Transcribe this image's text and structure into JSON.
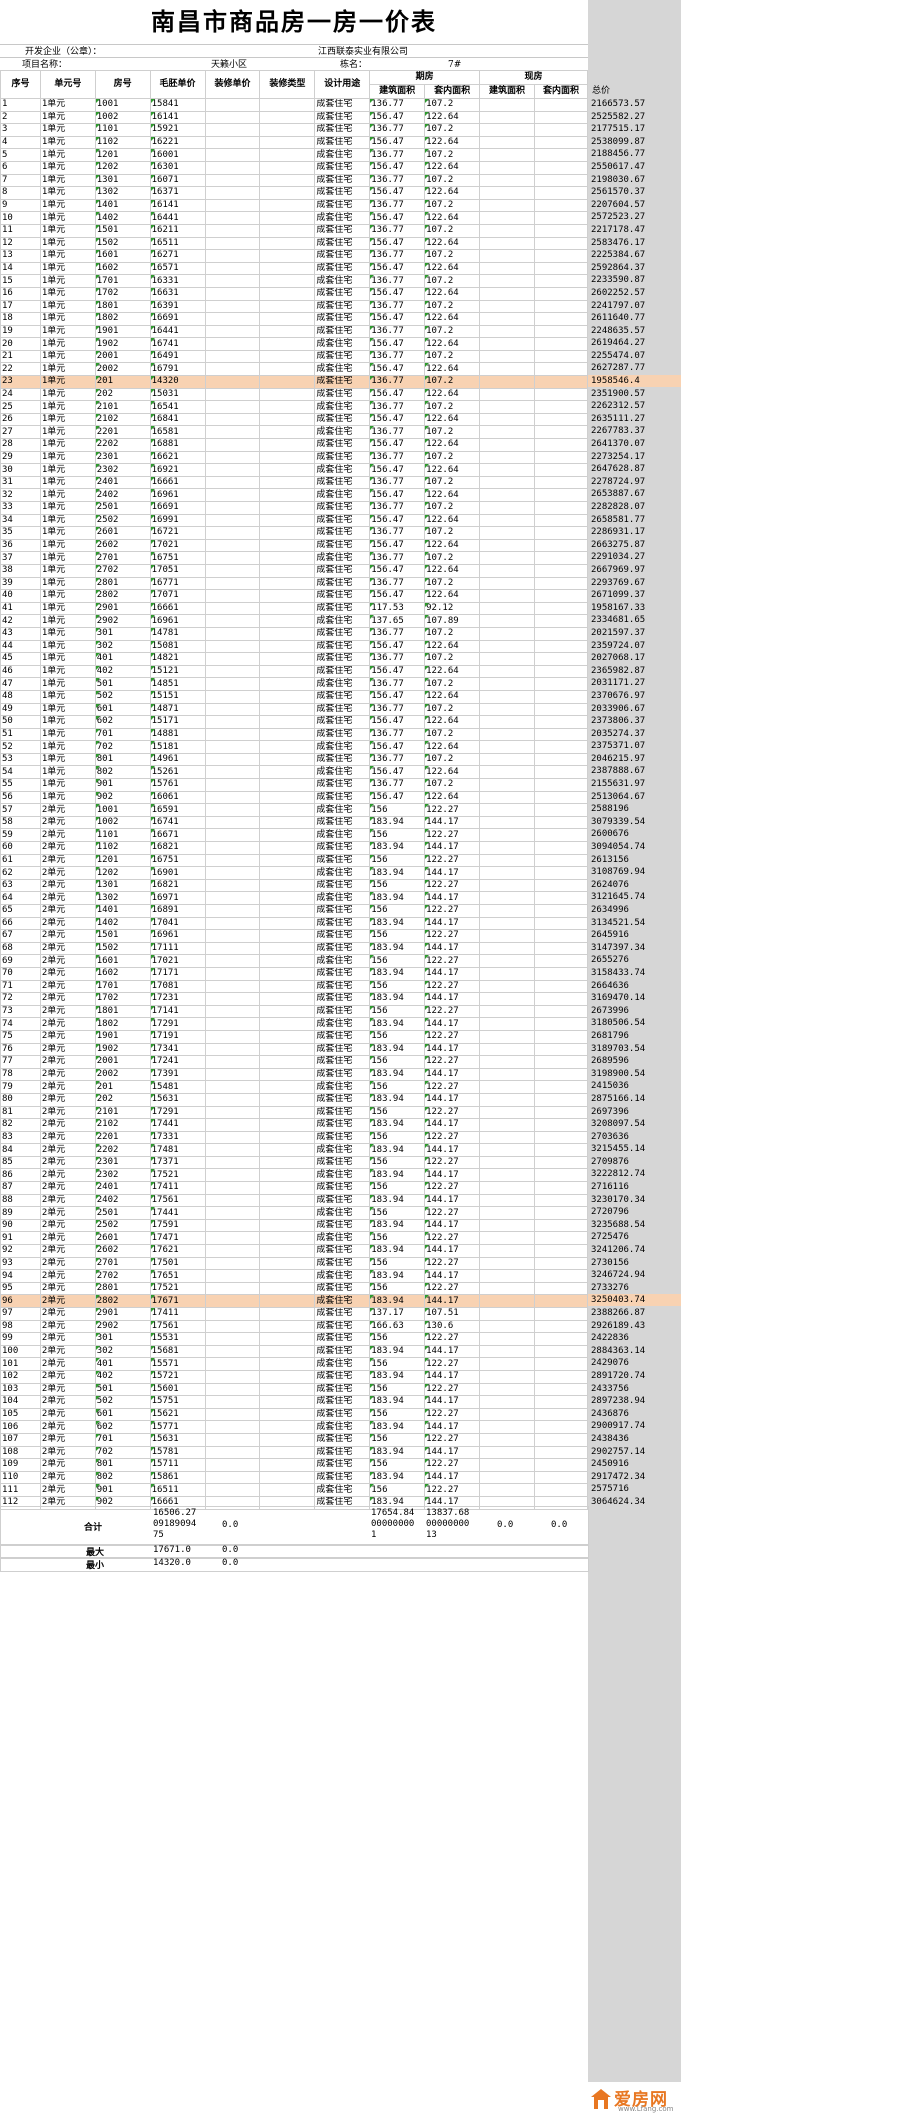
{
  "title": "南昌市商品房一房一价表",
  "developer_label": "开发企业（公章）：",
  "developer_value": "江西联泰实业有限公司",
  "project_label": "项目名称：",
  "project_value": "天籁小区",
  "building_label": "栋名：",
  "building_value": "7#",
  "headers": {
    "seq": "序号",
    "unit": "单元号",
    "room": "房号",
    "price": "毛胚单价",
    "deco_price": "装修单价",
    "deco_type": "装修类型",
    "usage": "设计用途",
    "future": "期房",
    "current": "现房",
    "build_area": "建筑面积",
    "inner_area": "套内面积",
    "build_area2": "建筑面积",
    "inner_area2": "套内面积",
    "total": "总价"
  },
  "usage_value": "成套住宅",
  "rows": [
    [
      "1",
      "1单元",
      "1001",
      "15841",
      "136.77",
      "107.2",
      "2166573.57"
    ],
    [
      "2",
      "1单元",
      "1002",
      "16141",
      "156.47",
      "122.64",
      "2525582.27"
    ],
    [
      "3",
      "1单元",
      "1101",
      "15921",
      "136.77",
      "107.2",
      "2177515.17"
    ],
    [
      "4",
      "1单元",
      "1102",
      "16221",
      "156.47",
      "122.64",
      "2538099.87"
    ],
    [
      "5",
      "1单元",
      "1201",
      "16001",
      "136.77",
      "107.2",
      "2188456.77"
    ],
    [
      "6",
      "1单元",
      "1202",
      "16301",
      "156.47",
      "122.64",
      "2550617.47"
    ],
    [
      "7",
      "1单元",
      "1301",
      "16071",
      "136.77",
      "107.2",
      "2198030.67"
    ],
    [
      "8",
      "1单元",
      "1302",
      "16371",
      "156.47",
      "122.64",
      "2561570.37"
    ],
    [
      "9",
      "1单元",
      "1401",
      "16141",
      "136.77",
      "107.2",
      "2207604.57"
    ],
    [
      "10",
      "1单元",
      "1402",
      "16441",
      "156.47",
      "122.64",
      "2572523.27"
    ],
    [
      "11",
      "1单元",
      "1501",
      "16211",
      "136.77",
      "107.2",
      "2217178.47"
    ],
    [
      "12",
      "1单元",
      "1502",
      "16511",
      "156.47",
      "122.64",
      "2583476.17"
    ],
    [
      "13",
      "1单元",
      "1601",
      "16271",
      "136.77",
      "107.2",
      "2225384.67"
    ],
    [
      "14",
      "1单元",
      "1602",
      "16571",
      "156.47",
      "122.64",
      "2592864.37"
    ],
    [
      "15",
      "1单元",
      "1701",
      "16331",
      "136.77",
      "107.2",
      "2233590.87"
    ],
    [
      "16",
      "1单元",
      "1702",
      "16631",
      "156.47",
      "122.64",
      "2602252.57"
    ],
    [
      "17",
      "1单元",
      "1801",
      "16391",
      "136.77",
      "107.2",
      "2241797.07"
    ],
    [
      "18",
      "1单元",
      "1802",
      "16691",
      "156.47",
      "122.64",
      "2611640.77"
    ],
    [
      "19",
      "1单元",
      "1901",
      "16441",
      "136.77",
      "107.2",
      "2248635.57"
    ],
    [
      "20",
      "1单元",
      "1902",
      "16741",
      "156.47",
      "122.64",
      "2619464.27"
    ],
    [
      "21",
      "1单元",
      "2001",
      "16491",
      "136.77",
      "107.2",
      "2255474.07"
    ],
    [
      "22",
      "1单元",
      "2002",
      "16791",
      "156.47",
      "122.64",
      "2627287.77"
    ],
    [
      "23",
      "1单元",
      "201",
      "14320",
      "136.77",
      "107.2",
      "1958546.4"
    ],
    [
      "24",
      "1单元",
      "202",
      "15031",
      "156.47",
      "122.64",
      "2351900.57"
    ],
    [
      "25",
      "1单元",
      "2101",
      "16541",
      "136.77",
      "107.2",
      "2262312.57"
    ],
    [
      "26",
      "1单元",
      "2102",
      "16841",
      "156.47",
      "122.64",
      "2635111.27"
    ],
    [
      "27",
      "1单元",
      "2201",
      "16581",
      "136.77",
      "107.2",
      "2267783.37"
    ],
    [
      "28",
      "1单元",
      "2202",
      "16881",
      "156.47",
      "122.64",
      "2641370.07"
    ],
    [
      "29",
      "1单元",
      "2301",
      "16621",
      "136.77",
      "107.2",
      "2273254.17"
    ],
    [
      "30",
      "1单元",
      "2302",
      "16921",
      "156.47",
      "122.64",
      "2647628.87"
    ],
    [
      "31",
      "1单元",
      "2401",
      "16661",
      "136.77",
      "107.2",
      "2278724.97"
    ],
    [
      "32",
      "1单元",
      "2402",
      "16961",
      "156.47",
      "122.64",
      "2653887.67"
    ],
    [
      "33",
      "1单元",
      "2501",
      "16691",
      "136.77",
      "107.2",
      "2282828.07"
    ],
    [
      "34",
      "1单元",
      "2502",
      "16991",
      "156.47",
      "122.64",
      "2658581.77"
    ],
    [
      "35",
      "1单元",
      "2601",
      "16721",
      "136.77",
      "107.2",
      "2286931.17"
    ],
    [
      "36",
      "1单元",
      "2602",
      "17021",
      "156.47",
      "122.64",
      "2663275.87"
    ],
    [
      "37",
      "1单元",
      "2701",
      "16751",
      "136.77",
      "107.2",
      "2291034.27"
    ],
    [
      "38",
      "1单元",
      "2702",
      "17051",
      "156.47",
      "122.64",
      "2667969.97"
    ],
    [
      "39",
      "1单元",
      "2801",
      "16771",
      "136.77",
      "107.2",
      "2293769.67"
    ],
    [
      "40",
      "1单元",
      "2802",
      "17071",
      "156.47",
      "122.64",
      "2671099.37"
    ],
    [
      "41",
      "1单元",
      "2901",
      "16661",
      "117.53",
      "92.12",
      "1958167.33"
    ],
    [
      "42",
      "1单元",
      "2902",
      "16961",
      "137.65",
      "107.89",
      "2334681.65"
    ],
    [
      "43",
      "1单元",
      "301",
      "14781",
      "136.77",
      "107.2",
      "2021597.37"
    ],
    [
      "44",
      "1单元",
      "302",
      "15081",
      "156.47",
      "122.64",
      "2359724.07"
    ],
    [
      "45",
      "1单元",
      "401",
      "14821",
      "136.77",
      "107.2",
      "2027068.17"
    ],
    [
      "46",
      "1单元",
      "402",
      "15121",
      "156.47",
      "122.64",
      "2365982.87"
    ],
    [
      "47",
      "1单元",
      "501",
      "14851",
      "136.77",
      "107.2",
      "2031171.27"
    ],
    [
      "48",
      "1单元",
      "502",
      "15151",
      "156.47",
      "122.64",
      "2370676.97"
    ],
    [
      "49",
      "1单元",
      "601",
      "14871",
      "136.77",
      "107.2",
      "2033906.67"
    ],
    [
      "50",
      "1单元",
      "602",
      "15171",
      "156.47",
      "122.64",
      "2373806.37"
    ],
    [
      "51",
      "1单元",
      "701",
      "14881",
      "136.77",
      "107.2",
      "2035274.37"
    ],
    [
      "52",
      "1单元",
      "702",
      "15181",
      "156.47",
      "122.64",
      "2375371.07"
    ],
    [
      "53",
      "1单元",
      "801",
      "14961",
      "136.77",
      "107.2",
      "2046215.97"
    ],
    [
      "54",
      "1单元",
      "802",
      "15261",
      "156.47",
      "122.64",
      "2387888.67"
    ],
    [
      "55",
      "1单元",
      "901",
      "15761",
      "136.77",
      "107.2",
      "2155631.97"
    ],
    [
      "56",
      "1单元",
      "902",
      "16061",
      "156.47",
      "122.64",
      "2513064.67"
    ],
    [
      "57",
      "2单元",
      "1001",
      "16591",
      "156",
      "122.27",
      "2588196"
    ],
    [
      "58",
      "2单元",
      "1002",
      "16741",
      "183.94",
      "144.17",
      "3079339.54"
    ],
    [
      "59",
      "2单元",
      "1101",
      "16671",
      "156",
      "122.27",
      "2600676"
    ],
    [
      "60",
      "2单元",
      "1102",
      "16821",
      "183.94",
      "144.17",
      "3094054.74"
    ],
    [
      "61",
      "2单元",
      "1201",
      "16751",
      "156",
      "122.27",
      "2613156"
    ],
    [
      "62",
      "2单元",
      "1202",
      "16901",
      "183.94",
      "144.17",
      "3108769.94"
    ],
    [
      "63",
      "2单元",
      "1301",
      "16821",
      "156",
      "122.27",
      "2624076"
    ],
    [
      "64",
      "2单元",
      "1302",
      "16971",
      "183.94",
      "144.17",
      "3121645.74"
    ],
    [
      "65",
      "2单元",
      "1401",
      "16891",
      "156",
      "122.27",
      "2634996"
    ],
    [
      "66",
      "2单元",
      "1402",
      "17041",
      "183.94",
      "144.17",
      "3134521.54"
    ],
    [
      "67",
      "2单元",
      "1501",
      "16961",
      "156",
      "122.27",
      "2645916"
    ],
    [
      "68",
      "2单元",
      "1502",
      "17111",
      "183.94",
      "144.17",
      "3147397.34"
    ],
    [
      "69",
      "2单元",
      "1601",
      "17021",
      "156",
      "122.27",
      "2655276"
    ],
    [
      "70",
      "2单元",
      "1602",
      "17171",
      "183.94",
      "144.17",
      "3158433.74"
    ],
    [
      "71",
      "2单元",
      "1701",
      "17081",
      "156",
      "122.27",
      "2664636"
    ],
    [
      "72",
      "2单元",
      "1702",
      "17231",
      "183.94",
      "144.17",
      "3169470.14"
    ],
    [
      "73",
      "2单元",
      "1801",
      "17141",
      "156",
      "122.27",
      "2673996"
    ],
    [
      "74",
      "2单元",
      "1802",
      "17291",
      "183.94",
      "144.17",
      "3180506.54"
    ],
    [
      "75",
      "2单元",
      "1901",
      "17191",
      "156",
      "122.27",
      "2681796"
    ],
    [
      "76",
      "2单元",
      "1902",
      "17341",
      "183.94",
      "144.17",
      "3189703.54"
    ],
    [
      "77",
      "2单元",
      "2001",
      "17241",
      "156",
      "122.27",
      "2689596"
    ],
    [
      "78",
      "2单元",
      "2002",
      "17391",
      "183.94",
      "144.17",
      "3198900.54"
    ],
    [
      "79",
      "2单元",
      "201",
      "15481",
      "156",
      "122.27",
      "2415036"
    ],
    [
      "80",
      "2单元",
      "202",
      "15631",
      "183.94",
      "144.17",
      "2875166.14"
    ],
    [
      "81",
      "2单元",
      "2101",
      "17291",
      "156",
      "122.27",
      "2697396"
    ],
    [
      "82",
      "2单元",
      "2102",
      "17441",
      "183.94",
      "144.17",
      "3208097.54"
    ],
    [
      "83",
      "2单元",
      "2201",
      "17331",
      "156",
      "122.27",
      "2703636"
    ],
    [
      "84",
      "2单元",
      "2202",
      "17481",
      "183.94",
      "144.17",
      "3215455.14"
    ],
    [
      "85",
      "2单元",
      "2301",
      "17371",
      "156",
      "122.27",
      "2709876"
    ],
    [
      "86",
      "2单元",
      "2302",
      "17521",
      "183.94",
      "144.17",
      "3222812.74"
    ],
    [
      "87",
      "2单元",
      "2401",
      "17411",
      "156",
      "122.27",
      "2716116"
    ],
    [
      "88",
      "2单元",
      "2402",
      "17561",
      "183.94",
      "144.17",
      "3230170.34"
    ],
    [
      "89",
      "2单元",
      "2501",
      "17441",
      "156",
      "122.27",
      "2720796"
    ],
    [
      "90",
      "2单元",
      "2502",
      "17591",
      "183.94",
      "144.17",
      "3235688.54"
    ],
    [
      "91",
      "2单元",
      "2601",
      "17471",
      "156",
      "122.27",
      "2725476"
    ],
    [
      "92",
      "2单元",
      "2602",
      "17621",
      "183.94",
      "144.17",
      "3241206.74"
    ],
    [
      "93",
      "2单元",
      "2701",
      "17501",
      "156",
      "122.27",
      "2730156"
    ],
    [
      "94",
      "2单元",
      "2702",
      "17651",
      "183.94",
      "144.17",
      "3246724.94"
    ],
    [
      "95",
      "2单元",
      "2801",
      "17521",
      "156",
      "122.27",
      "2733276"
    ],
    [
      "96",
      "2单元",
      "2802",
      "17671",
      "183.94",
      "144.17",
      "3250403.74"
    ],
    [
      "97",
      "2单元",
      "2901",
      "17411",
      "137.17",
      "107.51",
      "2388266.87"
    ],
    [
      "98",
      "2单元",
      "2902",
      "17561",
      "166.63",
      "130.6",
      "2926189.43"
    ],
    [
      "99",
      "2单元",
      "301",
      "15531",
      "156",
      "122.27",
      "2422836"
    ],
    [
      "100",
      "2单元",
      "302",
      "15681",
      "183.94",
      "144.17",
      "2884363.14"
    ],
    [
      "101",
      "2单元",
      "401",
      "15571",
      "156",
      "122.27",
      "2429076"
    ],
    [
      "102",
      "2单元",
      "402",
      "15721",
      "183.94",
      "144.17",
      "2891720.74"
    ],
    [
      "103",
      "2单元",
      "501",
      "15601",
      "156",
      "122.27",
      "2433756"
    ],
    [
      "104",
      "2单元",
      "502",
      "15751",
      "183.94",
      "144.17",
      "2897238.94"
    ],
    [
      "105",
      "2单元",
      "601",
      "15621",
      "156",
      "122.27",
      "2436876"
    ],
    [
      "106",
      "2单元",
      "602",
      "15771",
      "183.94",
      "144.17",
      "2900917.74"
    ],
    [
      "107",
      "2单元",
      "701",
      "15631",
      "156",
      "122.27",
      "2438436"
    ],
    [
      "108",
      "2单元",
      "702",
      "15781",
      "183.94",
      "144.17",
      "2902757.14"
    ],
    [
      "109",
      "2单元",
      "801",
      "15711",
      "156",
      "122.27",
      "2450916"
    ],
    [
      "110",
      "2单元",
      "802",
      "15861",
      "183.94",
      "144.17",
      "2917472.34"
    ],
    [
      "111",
      "2单元",
      "901",
      "16511",
      "156",
      "122.27",
      "2575716"
    ],
    [
      "112",
      "2单元",
      "902",
      "16661",
      "183.94",
      "144.17",
      "3064624.34"
    ]
  ],
  "highlighted_rows": [
    "23",
    "96"
  ],
  "summary": {
    "total_label": "合计",
    "avg_price": "16506.27\n09189094\n75",
    "deco_total": "0.0",
    "build_total": "17654.84\n00000000\n1",
    "inner_total": "13837.68\n00000000\n13",
    "build_total2": "0.0",
    "inner_total2": "0.0",
    "max_label": "最大",
    "max_price": "17671.0",
    "max_deco": "0.0",
    "min_label": "最小",
    "min_price": "14320.0",
    "min_deco": "0.0"
  },
  "logo": {
    "brand": "爱房网",
    "url": "www.Lfang.com"
  },
  "colors": {
    "highlight": "#f8d2b2",
    "marker": "#2e9a2e",
    "logo": "#e87722"
  }
}
